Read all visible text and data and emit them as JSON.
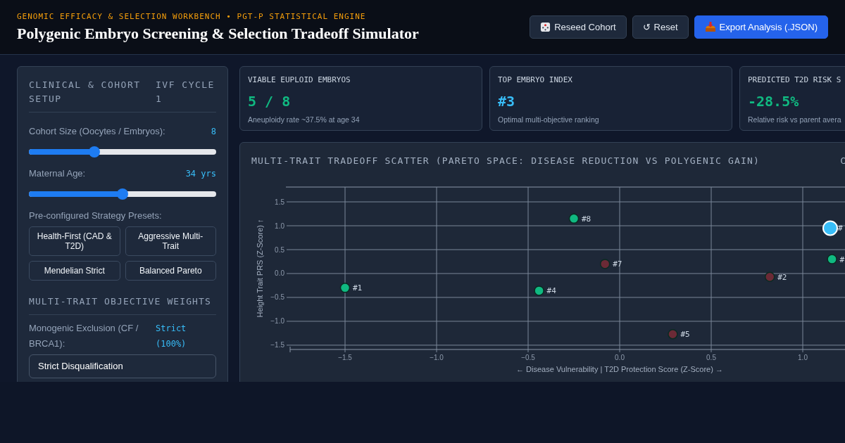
{
  "header": {
    "subtitle": "GENOMIC EFFICACY & SELECTION WORKBENCH • PGT-P STATISTICAL ENGINE",
    "title": "Polygenic Embryo Screening & Selection Tradeoff Simulator",
    "buttons": [
      {
        "kind": "dice",
        "label": "Reseed Cohort",
        "primary": false
      },
      {
        "kind": "glyph",
        "glyph": "↺",
        "label": "Reset",
        "primary": false
      },
      {
        "kind": "tray",
        "label": "Export Analysis (.JSON)",
        "primary": true
      }
    ]
  },
  "setup": {
    "title": "CLINICAL & COHORT SETUP",
    "cycle": "IVF CYCLE 1",
    "sliders": [
      {
        "label": "Cohort Size (Oocytes / Embryos):",
        "reading": "8",
        "level": 0.35
      },
      {
        "label": "Maternal Age:",
        "reading": "34 yrs",
        "level": 0.5
      }
    ],
    "presets_label": "Pre-configured Strategy Presets:",
    "presets": [
      "Health-First (CAD & T2D)",
      "Aggressive Multi-Trait",
      "Mendelian Strict",
      "Balanced Pareto"
    ],
    "weights_title": "MULTI-TRAIT OBJECTIVE WEIGHTS",
    "monogenic": {
      "label": "Monogenic Exclusion (CF / BRCA1):",
      "reading": "Strict (100%)",
      "value": "Strict Disqualification"
    }
  },
  "stats": [
    {
      "label": "VIABLE EUPLOID EMBRYOS",
      "value": "5 / 8",
      "color": "#10b981",
      "note": "Aneuploidy rate ~37.5% at age 34"
    },
    {
      "label": "TOP EMBRYO INDEX",
      "value": "#3",
      "color": "#38bdf8",
      "note": "Optimal multi-objective ranking"
    },
    {
      "label": "PREDICTED T2D RISK S",
      "value": "-28.5%",
      "color": "#10b981",
      "note": "Relative risk vs parent avera"
    }
  ],
  "chart_panel": {
    "title": "MULTI-TRAIT TRADEOFF SCATTER (PARETO SPACE: DISEASE REDUCTION VS POLYGENIC GAIN)",
    "cut_label": "C",
    "chart_data": {
      "type": "scatter",
      "xlabel": "← Disease Vulnerability | T2D Protection Score (Z-Score) →",
      "ylabel": "Height Trait PRS (Z-Score) ↑",
      "grid": true,
      "xlim": [
        -1.8,
        1.85
      ],
      "ylim": [
        -1.59,
        1.81
      ],
      "xticks": [
        {
          "value": -1.5,
          "label": "−1.5"
        },
        {
          "value": -1,
          "label": "−1.0"
        },
        {
          "value": -0.5,
          "label": "−0.5"
        },
        {
          "value": 0,
          "label": "0.0"
        },
        {
          "value": 0.5,
          "label": "0.5"
        },
        {
          "value": 1,
          "label": "1.0"
        }
      ],
      "yticks": [
        {
          "value": 1.5,
          "label": "1.5"
        },
        {
          "value": 1,
          "label": "1.0"
        },
        {
          "value": 0.5,
          "label": "0.5"
        },
        {
          "value": 0,
          "label": "0.0"
        },
        {
          "value": -0.5,
          "label": "−0.5"
        },
        {
          "value": -1,
          "label": "−1.0"
        },
        {
          "value": -1.5,
          "label": "−1.5"
        }
      ],
      "series": [
        {
          "color": "#10b981",
          "x": [
            -1.5,
            -0.25,
            -0.44,
            1.16
          ],
          "values": [
            -0.3,
            1.15,
            -0.36,
            0.3
          ]
        },
        {
          "color": "#6b2a36",
          "x": [
            -0.08,
            0.29,
            0.82
          ],
          "values": [
            0.2,
            -1.27,
            -0.07
          ]
        },
        {
          "color": "#38bdf8",
          "x": [
            1.15
          ],
          "values": [
            0.95
          ]
        }
      ],
      "annotations": [
        {
          "x": -1.5,
          "y": -0.3,
          "text": "#1"
        },
        {
          "x": -0.25,
          "y": 1.15,
          "text": "#8"
        },
        {
          "x": -0.44,
          "y": -0.36,
          "text": "#4"
        },
        {
          "x": 1.16,
          "y": 0.3,
          "text": "#"
        },
        {
          "x": -0.08,
          "y": 0.2,
          "text": "#7"
        },
        {
          "x": 0.29,
          "y": -1.27,
          "text": "#5"
        },
        {
          "x": 0.82,
          "y": -0.07,
          "text": "#2"
        },
        {
          "x": 1.15,
          "y": 0.95,
          "text": "#"
        }
      ]
    }
  }
}
